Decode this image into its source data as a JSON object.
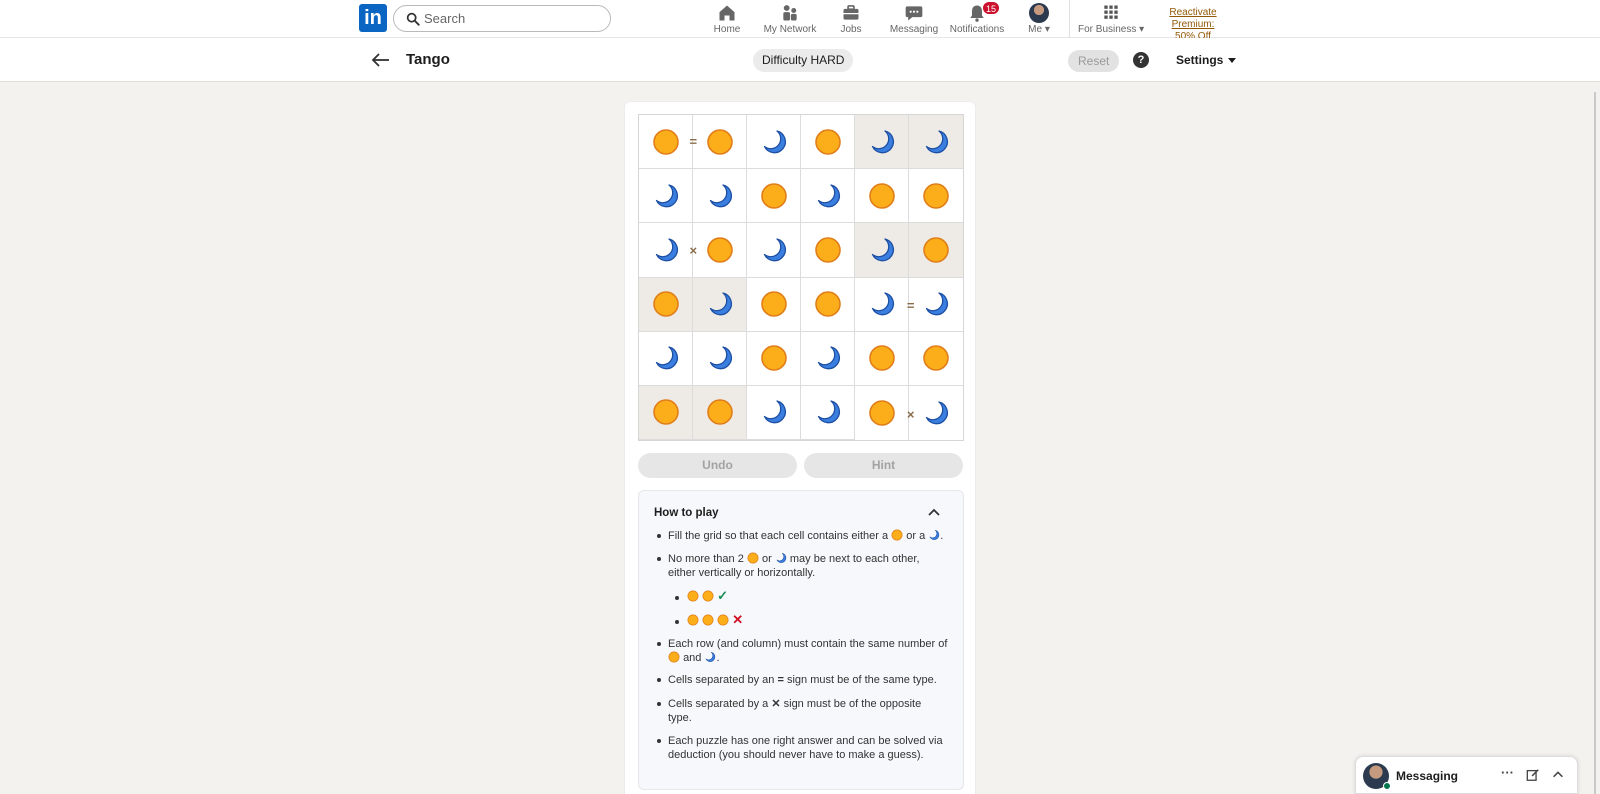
{
  "nav": {
    "logo": "in",
    "search_placeholder": "Search",
    "items": [
      {
        "label": "Home"
      },
      {
        "label": "My Network"
      },
      {
        "label": "Jobs"
      },
      {
        "label": "Messaging"
      },
      {
        "label": "Notifications",
        "badge": "15"
      },
      {
        "label": "Me"
      },
      {
        "label": "For Business"
      }
    ],
    "premium_line1": "Reactivate Premium:",
    "premium_line2": "50% Off"
  },
  "game": {
    "title": "Tango",
    "difficulty": "Difficulty HARD",
    "reset_label": "Reset",
    "help_label": "?",
    "settings_label": "Settings",
    "grid": [
      [
        "sun",
        "sun",
        "moon",
        "sun",
        "moon",
        "moon"
      ],
      [
        "moon",
        "moon",
        "sun",
        "moon",
        "sun",
        "sun"
      ],
      [
        "moon",
        "sun",
        "moon",
        "sun",
        "moon",
        "sun"
      ],
      [
        "sun",
        "moon",
        "sun",
        "sun",
        "moon",
        "moon"
      ],
      [
        "moon",
        "moon",
        "sun",
        "moon",
        "sun",
        "sun"
      ],
      [
        "sun",
        "sun",
        "moon",
        "moon",
        "sun",
        "moon"
      ]
    ],
    "locked": [
      [
        false,
        false,
        false,
        false,
        true,
        true
      ],
      [
        false,
        false,
        false,
        false,
        false,
        false
      ],
      [
        false,
        false,
        false,
        false,
        true,
        true
      ],
      [
        true,
        true,
        false,
        false,
        false,
        false
      ],
      [
        false,
        false,
        false,
        false,
        false,
        false
      ],
      [
        true,
        true,
        false,
        false,
        false,
        false
      ]
    ],
    "constraints": [
      {
        "row": 0,
        "col": 0,
        "dir": "right",
        "sign": "="
      },
      {
        "row": 2,
        "col": 0,
        "dir": "right",
        "sign": "×"
      },
      {
        "row": 3,
        "col": 4,
        "dir": "right",
        "sign": "="
      },
      {
        "row": 5,
        "col": 4,
        "dir": "right",
        "sign": "×"
      }
    ],
    "undo_label": "Undo",
    "hint_label": "Hint"
  },
  "howto": {
    "title": "How to play",
    "rule1_a": "Fill the grid so that each cell contains either a",
    "rule1_b": "or a",
    "rule1_c": ".",
    "rule2_a": "No more than 2",
    "rule2_b": "or",
    "rule2_c": "may be next to each other,",
    "rule2_d": "either vertically or horizontally.",
    "ex_good": "✓",
    "ex_bad": "✕",
    "rule3_a": "Each row (and column) must contain the same number of",
    "rule3_b": "and",
    "rule3_c": ".",
    "rule4_a": "Cells separated by an",
    "rule4_sign": "=",
    "rule4_b": "sign must be of the same type.",
    "rule5_a": "Cells separated by a",
    "rule5_sign": "✕",
    "rule5_b": "sign must be of the opposite",
    "rule5_c": "type.",
    "rule6_a": "Each puzzle has one right answer and can be solved via",
    "rule6_b": "deduction (you should never have to make a guess)."
  },
  "messaging": {
    "label": "Messaging",
    "more": "···"
  },
  "colors": {
    "sun_fill": "#fbad1a",
    "sun_stroke": "#e07e1a",
    "moon_fill": "#3a7fe0",
    "moon_stroke": "#1d4fa3",
    "brand": "#0a66c2",
    "badge": "#cb112d"
  }
}
